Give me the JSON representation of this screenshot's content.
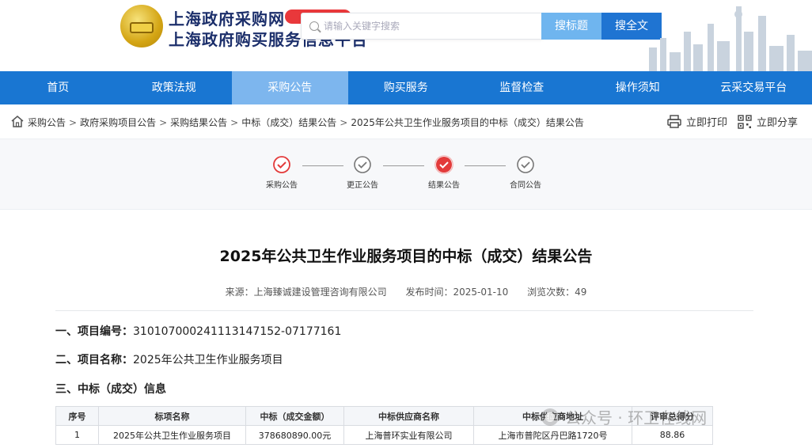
{
  "header": {
    "site_name": "上海政府采购网",
    "site_subname": "上海政府购买服务信息平台",
    "search_placeholder": "请输入关键字搜索",
    "search_title_button": "搜标题",
    "search_fulltext_button": "搜全文"
  },
  "nav": {
    "items": [
      {
        "label": "首页"
      },
      {
        "label": "政策法规"
      },
      {
        "label": "采购公告"
      },
      {
        "label": "购买服务"
      },
      {
        "label": "监督检查"
      },
      {
        "label": "操作须知"
      },
      {
        "label": "云采交易平台"
      }
    ],
    "active_index": 2
  },
  "breadcrumb": {
    "items": [
      "采购公告",
      "政府采购项目公告",
      "采购结果公告",
      "中标（成交）结果公告",
      "2025年公共卫生作业服务项目的中标（成交）结果公告"
    ],
    "separator": ">"
  },
  "actions": {
    "print_label": "立即打印",
    "share_label": "立即分享"
  },
  "steps": [
    {
      "label": "采购公告",
      "state": "active"
    },
    {
      "label": "更正公告",
      "state": "done"
    },
    {
      "label": "结果公告",
      "state": "current"
    },
    {
      "label": "合同公告",
      "state": "done"
    }
  ],
  "document": {
    "title": "2025年公共卫生作业服务项目的中标（成交）结果公告",
    "source": "来源：上海臻诚建设管理咨询有限公司",
    "publish_time": "发布时间：2025-01-10",
    "views": "浏览次数：49",
    "section1_label": "一、项目编号：",
    "section1_value": "310107000241113147152-07177161",
    "section2_label": "二、项目名称：",
    "section2_value": "2025年公共卫生作业服务项目",
    "section3_label": "三、中标（成交）信息"
  },
  "table": {
    "headers": [
      "序号",
      "标项名称",
      "中标（成交金额）",
      "中标供应商名称",
      "中标供应商地址",
      "评审总得分"
    ],
    "rows": [
      [
        "1",
        "2025年公共卫生作业服务项目",
        "378680890.00元",
        "上海普环实业有限公司",
        "上海市普陀区丹巴路1720号",
        "88.86"
      ]
    ]
  },
  "watermark": {
    "text": "公众号 · 环卫在线网"
  },
  "colors": {
    "nav_bg": "#1976d2",
    "nav_active_bg": "#7db6ee",
    "search_title_bg": "#6fb5ef",
    "search_full_bg": "#1f74d2",
    "step_active": "#e33b3b",
    "step_done": "#777777",
    "brand_text": "#1c2f6b"
  }
}
